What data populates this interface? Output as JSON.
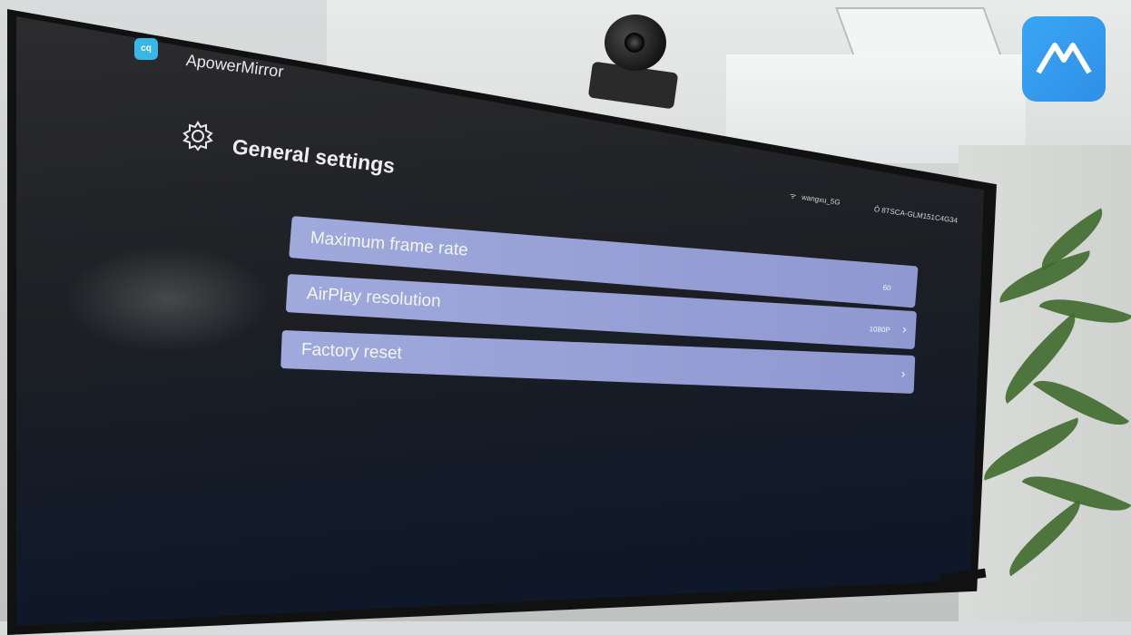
{
  "app": {
    "name": "ApowerMirror",
    "logo_text": "cq"
  },
  "page": {
    "title": "General settings",
    "icon": "gear-icon"
  },
  "status": {
    "wifi_name": "wangxu_5G",
    "device_id": "Ô 8TSCA-GLM151C4G34"
  },
  "settings": [
    {
      "label": "Maximum frame rate",
      "value": "60",
      "has_chevron": false
    },
    {
      "label": "AirPlay resolution",
      "value": "1080P",
      "has_chevron": true
    },
    {
      "label": "Factory reset",
      "value": "",
      "has_chevron": true
    }
  ],
  "colors": {
    "row_bg": "#9aa3d8",
    "logo_blue": "#38b6e8",
    "badge_blue": "#3aa6f4"
  }
}
